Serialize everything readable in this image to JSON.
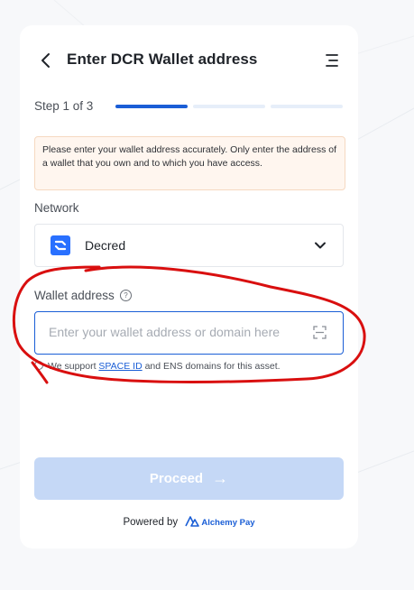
{
  "header": {
    "title": "Enter DCR Wallet address",
    "back_icon": "chevron-left-icon",
    "menu_icon": "menu-icon"
  },
  "stepper": {
    "label": "Step 1 of 3",
    "current": 1,
    "total": 3
  },
  "notice": {
    "text": "Please enter your wallet address accurately. Only enter the address of a wallet that you own and to which you have access."
  },
  "network": {
    "label": "Network",
    "selected": "Decred",
    "icon": "decred-icon"
  },
  "wallet": {
    "label": "Wallet address",
    "placeholder": "Enter your wallet address or domain here",
    "value": "",
    "support_prefix": "We support ",
    "support_link": "SPACE ID",
    "support_suffix": " and ENS domains for this asset."
  },
  "actions": {
    "proceed_label": "Proceed",
    "proceed_arrow": "→"
  },
  "footer": {
    "powered_by": "Powered by",
    "brand": "Alchemy Pay"
  },
  "colors": {
    "accent": "#1a5ed6",
    "proceed_disabled": "#c5d8f6",
    "notice_bg": "#fff6ef",
    "annotation": "#d90f0f"
  }
}
